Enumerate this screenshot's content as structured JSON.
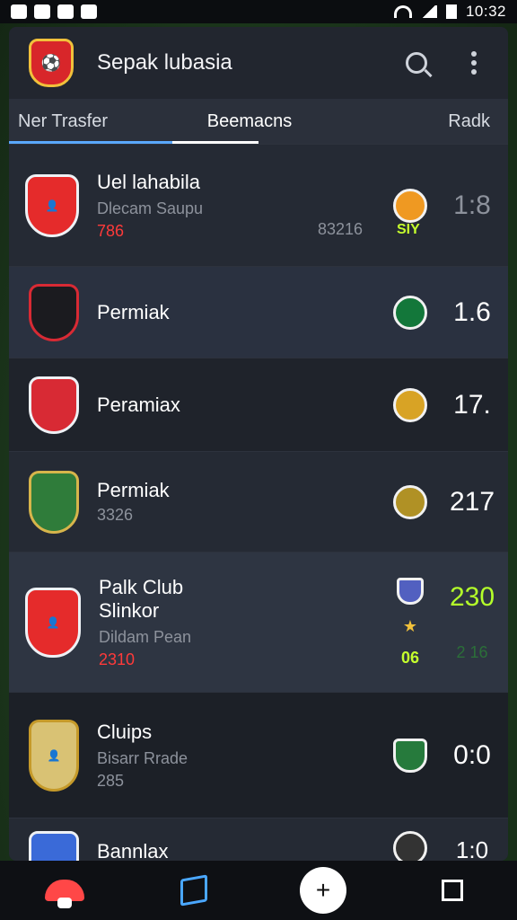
{
  "status": {
    "time": "10:32"
  },
  "app": {
    "title": "Sepak lubasia",
    "icons": [
      "search-icon",
      "more-vertical-icon"
    ],
    "logo_text": "⚽"
  },
  "tabs": [
    {
      "label": "Ner Trasfer"
    },
    {
      "label": "Beemacns"
    },
    {
      "label": "Radk"
    }
  ],
  "rows": [
    {
      "type": "player",
      "name": "Uel lahabila",
      "sub": "Dlecam Saupu",
      "num": "786",
      "code": "83216",
      "tag": "SIY",
      "score": "1:8",
      "crest_color": "#e52b2b",
      "mini_color": "#ef9922"
    },
    {
      "type": "club",
      "name": "Permiak",
      "score": "1.6",
      "crest_color": "#1b1b1f",
      "mini_color": "#13773a"
    },
    {
      "type": "club",
      "name": "Peramiax",
      "score": "17.",
      "crest_color": "#d82a34",
      "mini_color": "#d8a325"
    },
    {
      "type": "club",
      "name": "Permiak",
      "sub": "3326",
      "score": "217",
      "crest_color": "#2f7c3a",
      "mini_color": "#b09125"
    },
    {
      "type": "player",
      "name": "Palk Club",
      "name2": "Slinkor",
      "sub": "Dildam Pean",
      "num": "2310",
      "score": "230",
      "score2": "2 16",
      "tag": "06",
      "crest_color": "#e52b2b",
      "mini_color": "#5260c0"
    },
    {
      "type": "club",
      "name": "Cluips",
      "sub": "Bisarr Rrade",
      "num": "285",
      "score": "0:0",
      "crest_color": "#d9c274",
      "mini_color": "#267a3c"
    },
    {
      "type": "club",
      "name": "Bannlax",
      "score": "1:0",
      "crest_color": "#3a6ad8",
      "mini_color": "#333"
    }
  ],
  "bottom_nav": {
    "items": [
      "home-icon",
      "flag-icon",
      "add-icon",
      "square-icon"
    ],
    "center_label": "+"
  },
  "colors": {
    "accent": "#5aa8ff",
    "score_green": "#b4ff2a",
    "red_num": "#ff3a3a",
    "panel": "#20242d"
  }
}
